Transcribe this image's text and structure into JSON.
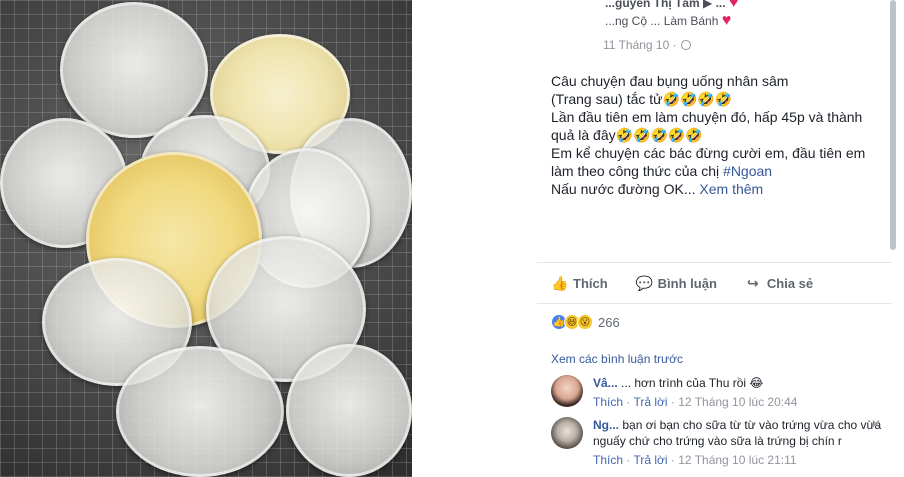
{
  "post": {
    "author_line": "...guyễn Thị Tâm ▶ ...",
    "group_line": "...ng Cộ ... Làm Bánh",
    "timestamp": "11 Tháng 10 ·",
    "body_lines": [
      "Câu chuyện đau bụng uống nhân sâm",
      "(Trang sau) tắc tử🤣🤣🤣🤣",
      "Lần đầu tiên em làm chuyện đó, hấp 45p và thành",
      "quả là đây🤣🤣🤣🤣🤣",
      "Em kể chuyện các bác đừng cười em, đầu tiên em",
      "làm theo công thức của chị "
    ],
    "hashtag": "#Ngoan",
    "last_line": "Nấu nước đường OK... ",
    "see_more": "Xem thêm"
  },
  "actions": {
    "like": "Thích",
    "comment": "Bình luận",
    "share": "Chia sẻ"
  },
  "reactions": {
    "count": "266"
  },
  "comments_section": {
    "view_previous": "Xem các bình luận trước",
    "comments": [
      {
        "name": "Vâ...",
        "text": "... hơn trình của Thu rồi 😂",
        "like": "Thích",
        "reply": "Trả lời",
        "time": "12 Tháng 10 lúc 20:44"
      },
      {
        "name": "Ng...",
        "text": "bạn ơi bạn cho sữa từ từ vào trứng vừa cho vừa nguấy chứ cho trứng vào sữa là trứng bị chín r",
        "like": "Thích",
        "reply": "Trả lời",
        "time": "12 Tháng 10 lúc 21:11",
        "close": "✕"
      }
    ]
  },
  "colors": {
    "link": "#365899",
    "meta": "#90949c",
    "heart": "#e0245e"
  }
}
